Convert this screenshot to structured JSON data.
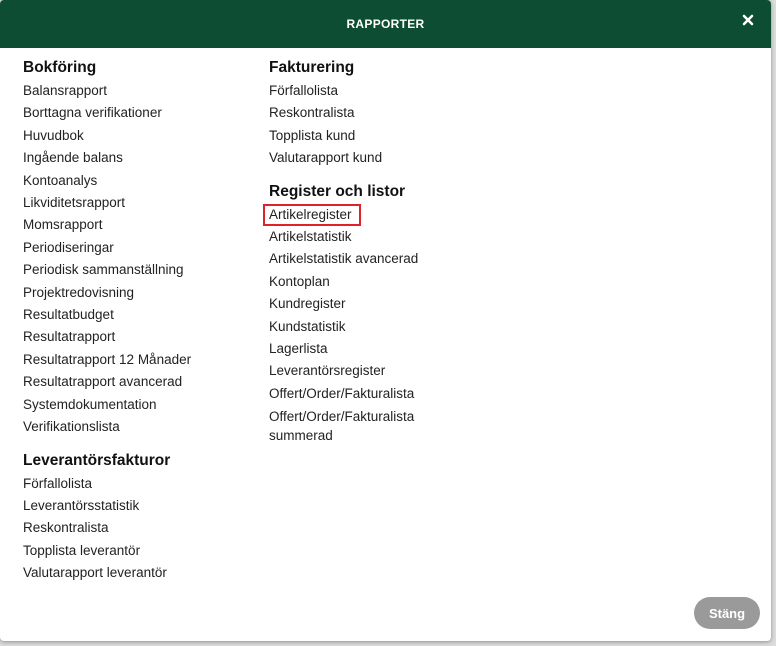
{
  "dialog": {
    "title": "RAPPORTER",
    "close_icon": "close-icon",
    "close_button": "Stäng",
    "header_color": "#0d4d34",
    "highlight_color": "#e0202a"
  },
  "left": {
    "bokforing": {
      "title": "Bokföring",
      "items": [
        "Balansrapport",
        "Borttagna verifikationer",
        "Huvudbok",
        "Ingående balans",
        "Kontoanalys",
        "Likviditetsrapport",
        "Momsrapport",
        "Periodiseringar",
        "Periodisk sammanställning",
        "Projektredovisning",
        "Resultatbudget",
        "Resultatrapport",
        "Resultatrapport 12 Månader",
        "Resultatrapport avancerad",
        "Systemdokumentation",
        "Verifikationslista"
      ]
    },
    "leverantorsfakturor": {
      "title": "Leverantörsfakturor",
      "items": [
        "Förfallolista",
        "Leverantörsstatistik",
        "Reskontralista",
        "Topplista leverantör",
        "Valutarapport leverantör"
      ]
    }
  },
  "right": {
    "fakturering": {
      "title": "Fakturering",
      "items": [
        "Förfallolista",
        "Reskontralista",
        "Topplista kund",
        "Valutarapport kund"
      ]
    },
    "register": {
      "title": "Register och listor",
      "items": [
        "Artikelregister",
        "Artikelstatistik",
        "Artikelstatistik avancerad",
        "Kontoplan",
        "Kundregister",
        "Kundstatistik",
        "Lagerlista",
        "Leverantörsregister",
        "Offert/Order/Fakturalista",
        "Offert/Order/Fakturalista summerad"
      ]
    }
  }
}
